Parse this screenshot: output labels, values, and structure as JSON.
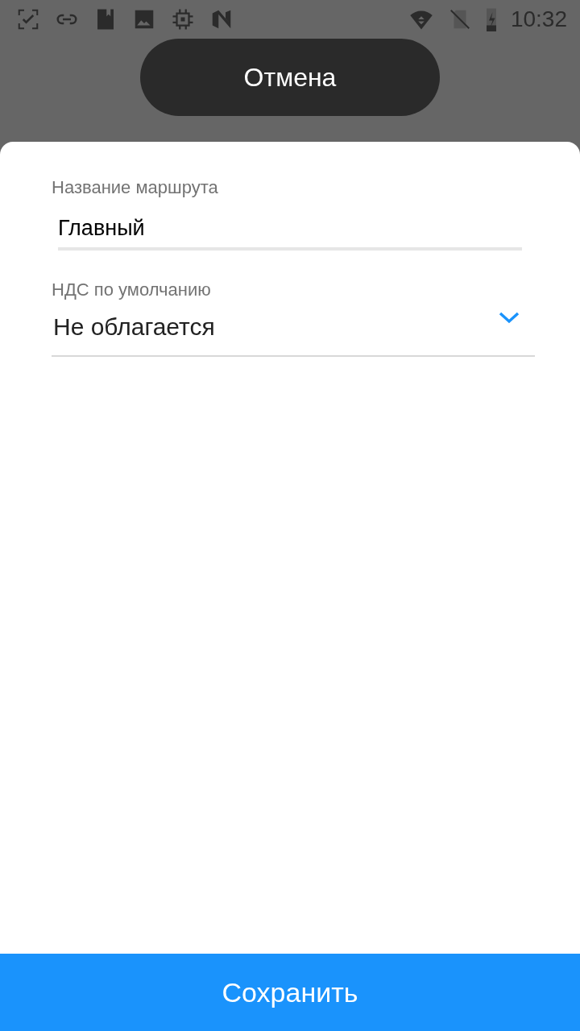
{
  "status_bar": {
    "time": "10:32"
  },
  "cancel_button": {
    "label": "Отмена"
  },
  "form": {
    "fields": [
      {
        "kind": "text",
        "label": "Название маршрута",
        "value": "Главный"
      },
      {
        "kind": "dropdown",
        "label": "НДС по умолчанию",
        "value": "Не облагается"
      }
    ]
  },
  "save_button": {
    "label": "Сохранить"
  }
}
